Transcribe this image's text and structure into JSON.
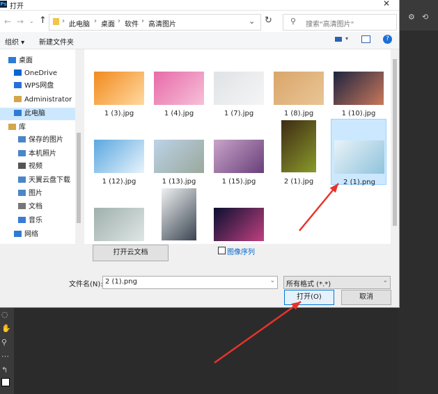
{
  "window": {
    "title": "打开",
    "logo": "Ps"
  },
  "nav": {
    "back_icon": "arrow-left-icon",
    "forward_icon": "arrow-right-icon",
    "up_icon": "arrow-up-icon",
    "breadcrumb": [
      "此电脑",
      "桌面",
      "软件",
      "高清图片"
    ],
    "refresh_icon": "refresh-icon",
    "search_placeholder": "搜索\"高清图片\""
  },
  "toolbar": {
    "organize": "组织 ▾",
    "new_folder": "新建文件夹"
  },
  "sidebar": {
    "items": [
      {
        "label": "桌面",
        "icon": "desktop-icon",
        "color": "#2e7bd6"
      },
      {
        "label": "OneDrive",
        "icon": "cloud-icon",
        "color": "#0a64d2"
      },
      {
        "label": "WPS网盘",
        "icon": "cloud-drive-icon",
        "color": "#2a6fd8"
      },
      {
        "label": "Administrator",
        "icon": "user-icon",
        "color": "#d4a54a"
      },
      {
        "label": "此电脑",
        "icon": "computer-icon",
        "color": "#2e7bd6",
        "selected": true
      },
      {
        "label": "库",
        "icon": "library-icon",
        "color": "#d4a54a"
      },
      {
        "label": "保存的图片",
        "icon": "pictures-icon",
        "color": "#4a86c8"
      },
      {
        "label": "本机照片",
        "icon": "pictures-icon",
        "color": "#4a86c8"
      },
      {
        "label": "视频",
        "icon": "video-icon",
        "color": "#555"
      },
      {
        "label": "天翼云盘下载",
        "icon": "download-icon",
        "color": "#4a86c8"
      },
      {
        "label": "图片",
        "icon": "pictures-icon",
        "color": "#4a86c8"
      },
      {
        "label": "文档",
        "icon": "document-icon",
        "color": "#777"
      },
      {
        "label": "音乐",
        "icon": "music-icon",
        "color": "#3a7bd5"
      },
      {
        "label": "网络",
        "icon": "network-icon",
        "color": "#2e7bd6"
      }
    ]
  },
  "files": [
    {
      "name": "1 (3).jpg",
      "colors": [
        "#f28a1e",
        "#ffd9a0"
      ],
      "portrait": false
    },
    {
      "name": "1 (4).jpg",
      "colors": [
        "#e86aa8",
        "#f6c0d8"
      ],
      "portrait": false
    },
    {
      "name": "1 (7).jpg",
      "colors": [
        "#dfe3e6",
        "#f5f5f5"
      ],
      "portrait": false
    },
    {
      "name": "1 (8).jpg",
      "colors": [
        "#d9a66a",
        "#eac596"
      ],
      "portrait": false
    },
    {
      "name": "1 (10).jpg",
      "colors": [
        "#1d2440",
        "#c9785a"
      ],
      "portrait": false
    },
    {
      "name": "1 (12).jpg",
      "colors": [
        "#5aa7e0",
        "#e8f3fb"
      ],
      "portrait": false
    },
    {
      "name": "1 (13).jpg",
      "colors": [
        "#bcd3e8",
        "#9aa89c"
      ],
      "portrait": false
    },
    {
      "name": "1 (15).jpg",
      "colors": [
        "#c8a4c9",
        "#6a3f7a"
      ],
      "portrait": false
    },
    {
      "name": "2 (1).jpg",
      "colors": [
        "#3d2a14",
        "#8a9a2a"
      ],
      "portrait": true
    },
    {
      "name": "2 (1).png",
      "colors": [
        "#e9f3f8",
        "#8fc3dc"
      ],
      "portrait": false,
      "selected": true
    },
    {
      "name": "",
      "colors": [
        "#9fb0ad",
        "#dfe6e4"
      ],
      "portrait": false
    },
    {
      "name": "",
      "colors": [
        "#eef1f2",
        "#3a4450"
      ],
      "portrait": true
    },
    {
      "name": "",
      "colors": [
        "#0a1030",
        "#c04080"
      ],
      "portrait": false
    }
  ],
  "bottom": {
    "cloud_button": "打开云文档",
    "image_sequence": "图像序列",
    "filename_label": "文件名(N):",
    "filename_value": "2 (1).png",
    "filetype_value": "所有格式 (*.*)",
    "open_button": "打开(O)",
    "cancel_button": "取消"
  },
  "annotation_color": "#e8332a"
}
